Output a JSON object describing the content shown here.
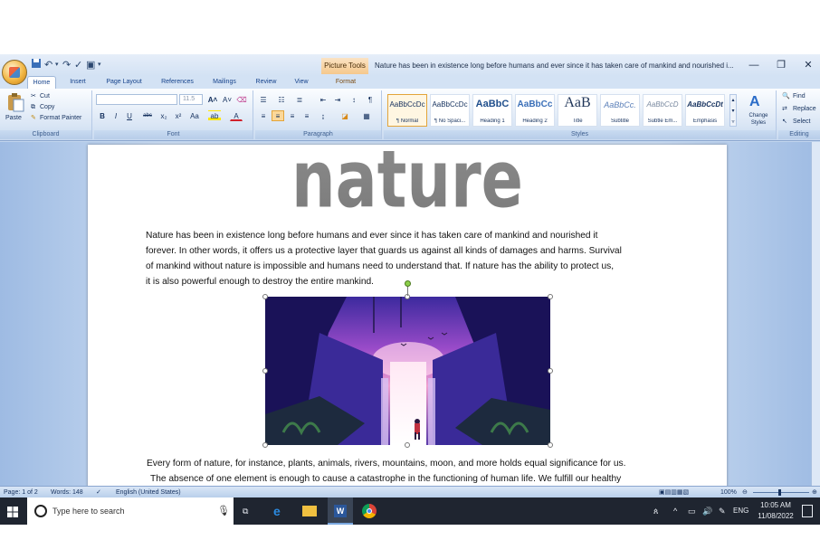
{
  "titlebar": {
    "context_tab": "Picture Tools",
    "document_title": "Nature has been in existence long before humans and ever since it has taken care of mankind and nourished i...",
    "minimize": "—",
    "restore": "❐",
    "close": "✕"
  },
  "tabs": [
    "Home",
    "Insert",
    "Page Layout",
    "References",
    "Mailings",
    "Review",
    "View",
    "Format"
  ],
  "ribbon": {
    "clipboard": {
      "paste": "Paste",
      "cut": "Cut",
      "copy": "Copy",
      "format_painter": "Format Painter",
      "label": "Clipboard"
    },
    "font": {
      "size": "11.5",
      "label": "Font"
    },
    "paragraph": {
      "label": "Paragraph"
    },
    "styles": {
      "label": "Styles",
      "items": [
        {
          "preview": "AaBbCcDc",
          "name": "¶ Normal"
        },
        {
          "preview": "AaBbCcDc",
          "name": "¶ No Spaci..."
        },
        {
          "preview": "AaBbC",
          "name": "Heading 1"
        },
        {
          "preview": "AaBbCc",
          "name": "Heading 2"
        },
        {
          "preview": "AaB",
          "name": "Title"
        },
        {
          "preview": "AaBbCc.",
          "name": "Subtitle"
        },
        {
          "preview": "AaBbCcD",
          "name": "Subtle Em..."
        },
        {
          "preview": "AaBbCcDt",
          "name": "Emphasis"
        }
      ],
      "change_styles": "Change Styles"
    },
    "editing": {
      "find": "Find",
      "replace": "Replace",
      "select": "Select",
      "label": "Editing"
    }
  },
  "document": {
    "wordart": "nature",
    "paragraph1": [
      "Nature has been in existence long before humans and ever since it has taken care of mankind and nourished it",
      "forever. In other words, it offers us a protective layer that guards us against all kinds of damages and harms. Survival",
      "of mankind without nature is impossible and humans need to understand that. If nature has the ability to protect us,",
      "it is also powerful enough to destroy the entire mankind."
    ],
    "paragraph2": [
      "Every form of nature, for instance, plants, animals, rivers, mountains, moon, and more holds equal significance for us.",
      "The absence of one element is enough to cause a catastrophe in the functioning of human life. We fulfill our healthy"
    ]
  },
  "statusbar": {
    "page": "Page: 1 of 2",
    "words": "Words: 148",
    "language": "English (United States)",
    "zoom": "100%"
  },
  "taskbar": {
    "search_placeholder": "Type here to search",
    "language": "ENG",
    "time": "10:05 AM",
    "date": "11/08/2022"
  },
  "colors": {
    "ribbon_bg": "#dae6f5",
    "wordart_gray": "#808080",
    "taskbar": "#1f2530"
  }
}
